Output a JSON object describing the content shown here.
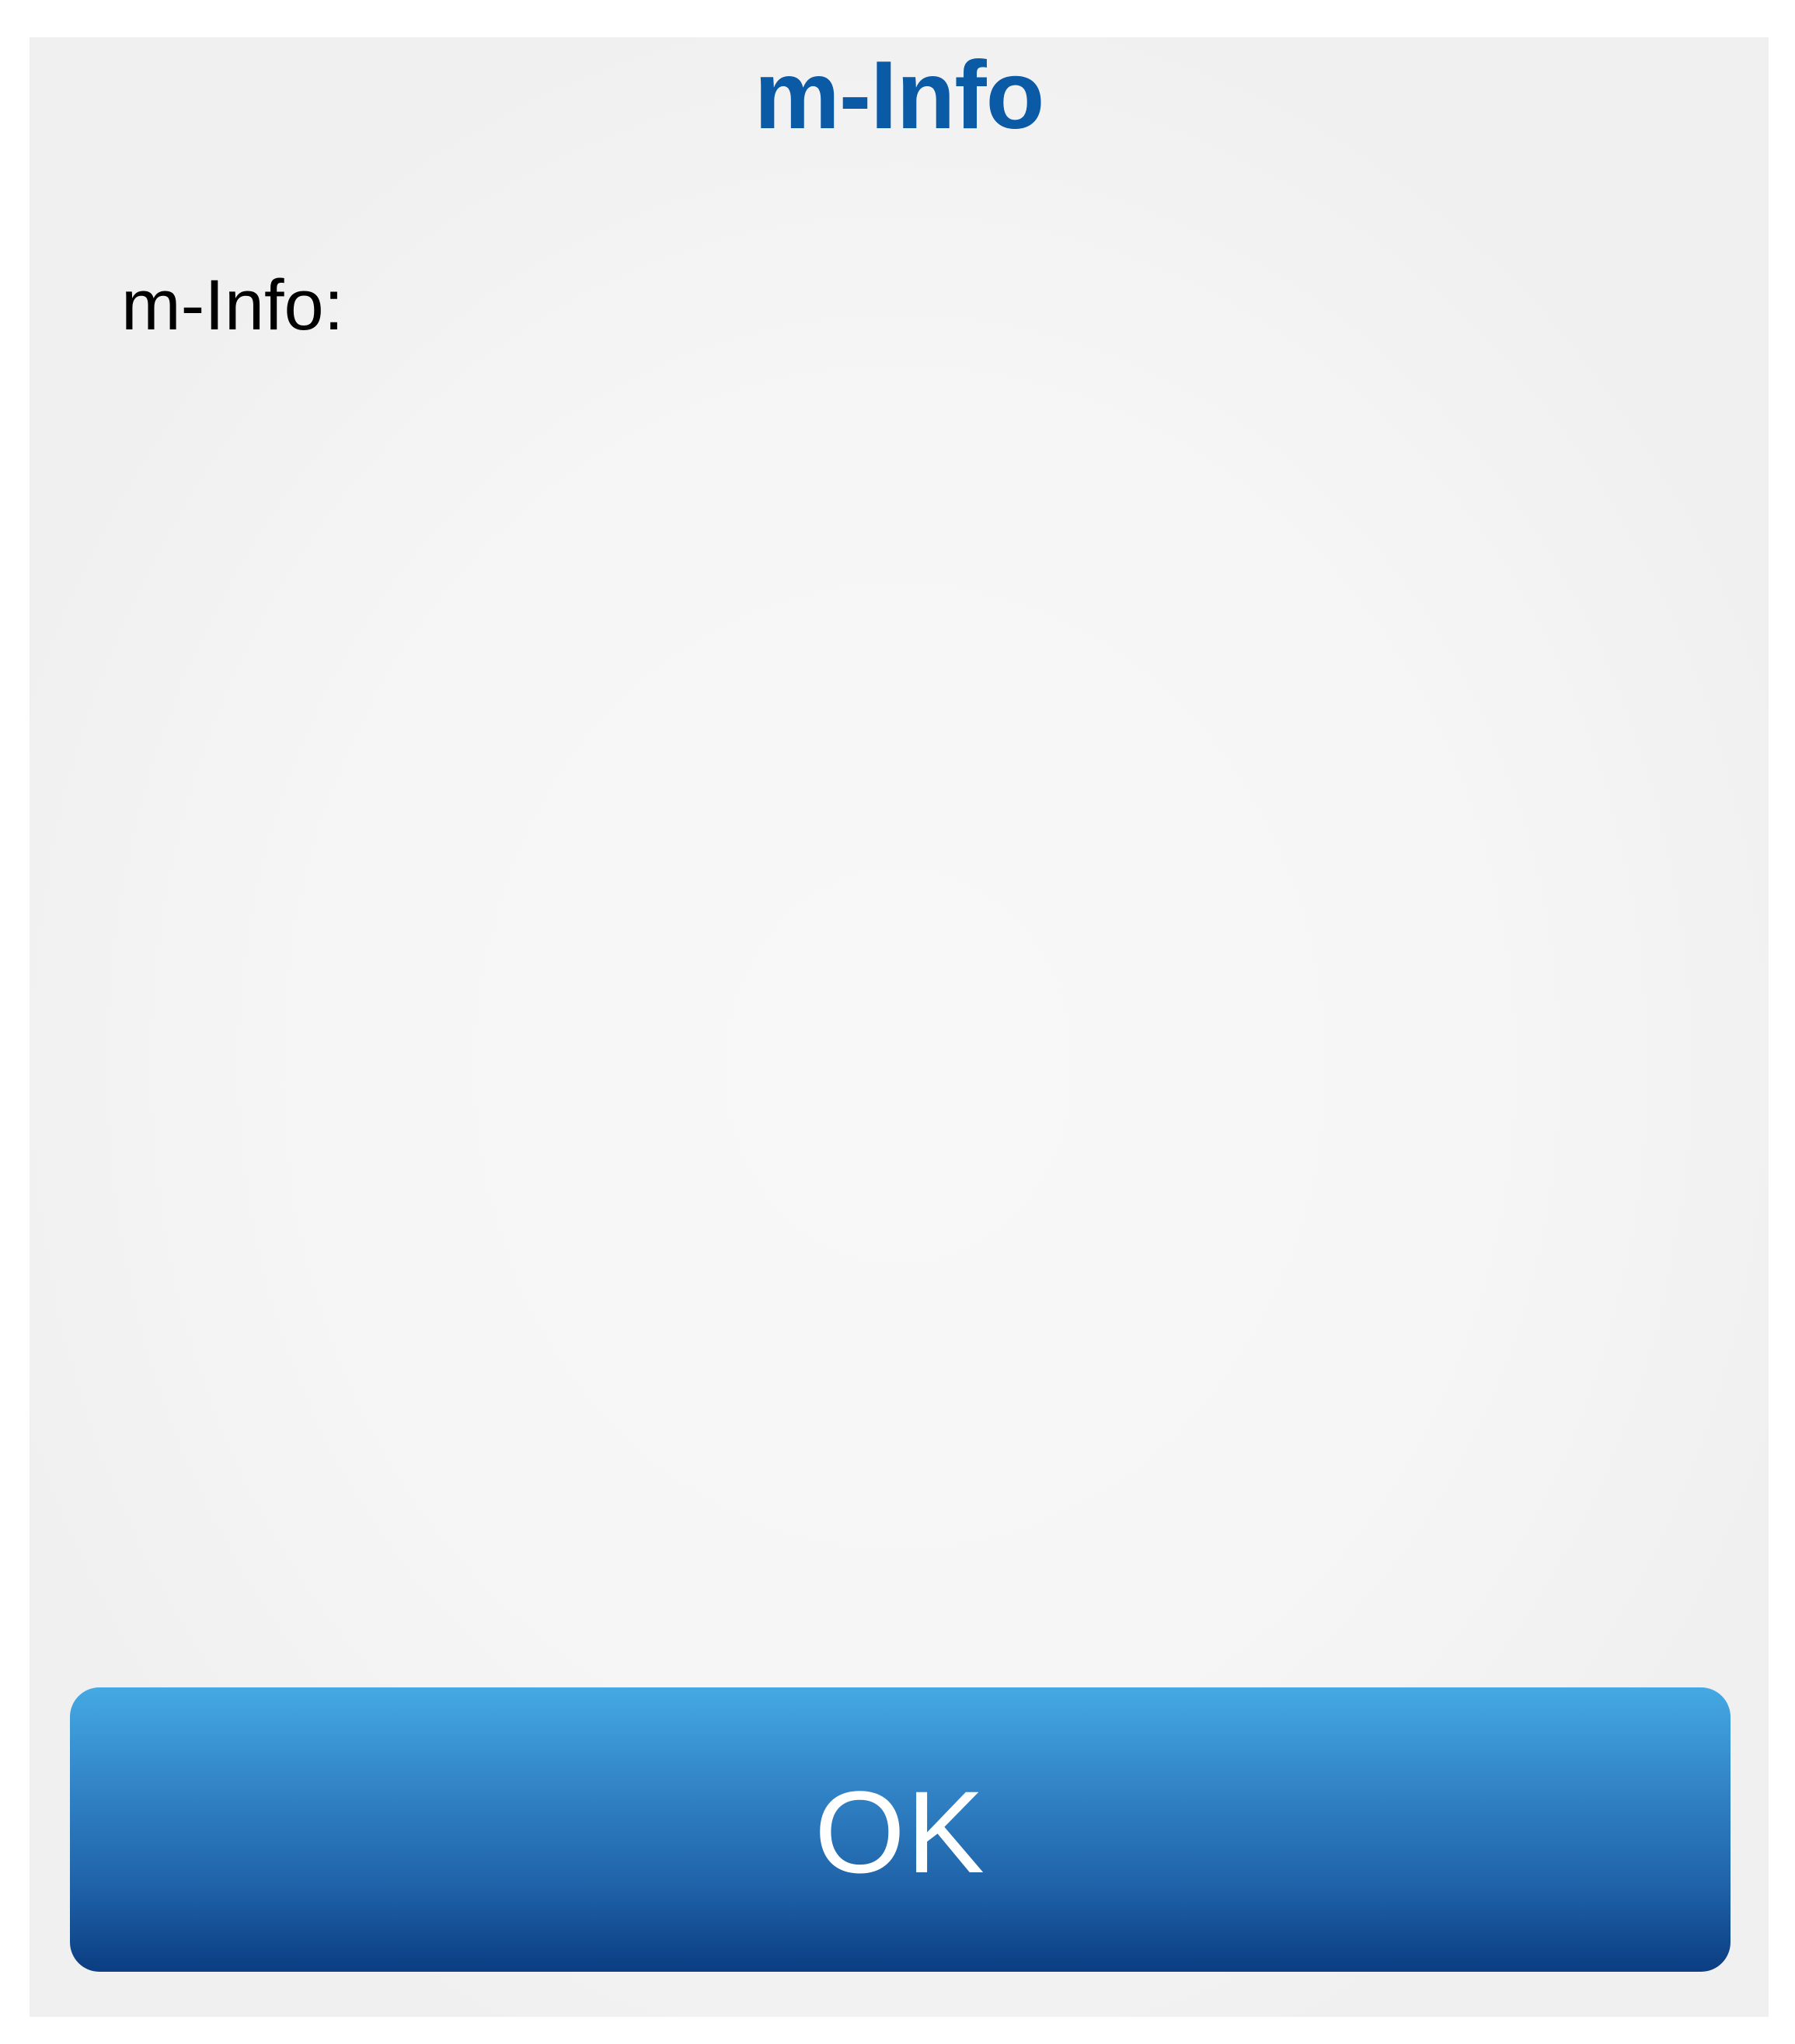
{
  "dialog": {
    "title": "m-Info",
    "info_label": "m-Info:",
    "ok_label": "OK"
  },
  "colors": {
    "title": "#0a5aa6",
    "button_top": "#45a9e3",
    "button_bottom": "#0b3d82",
    "background": "#f0f0f0"
  }
}
